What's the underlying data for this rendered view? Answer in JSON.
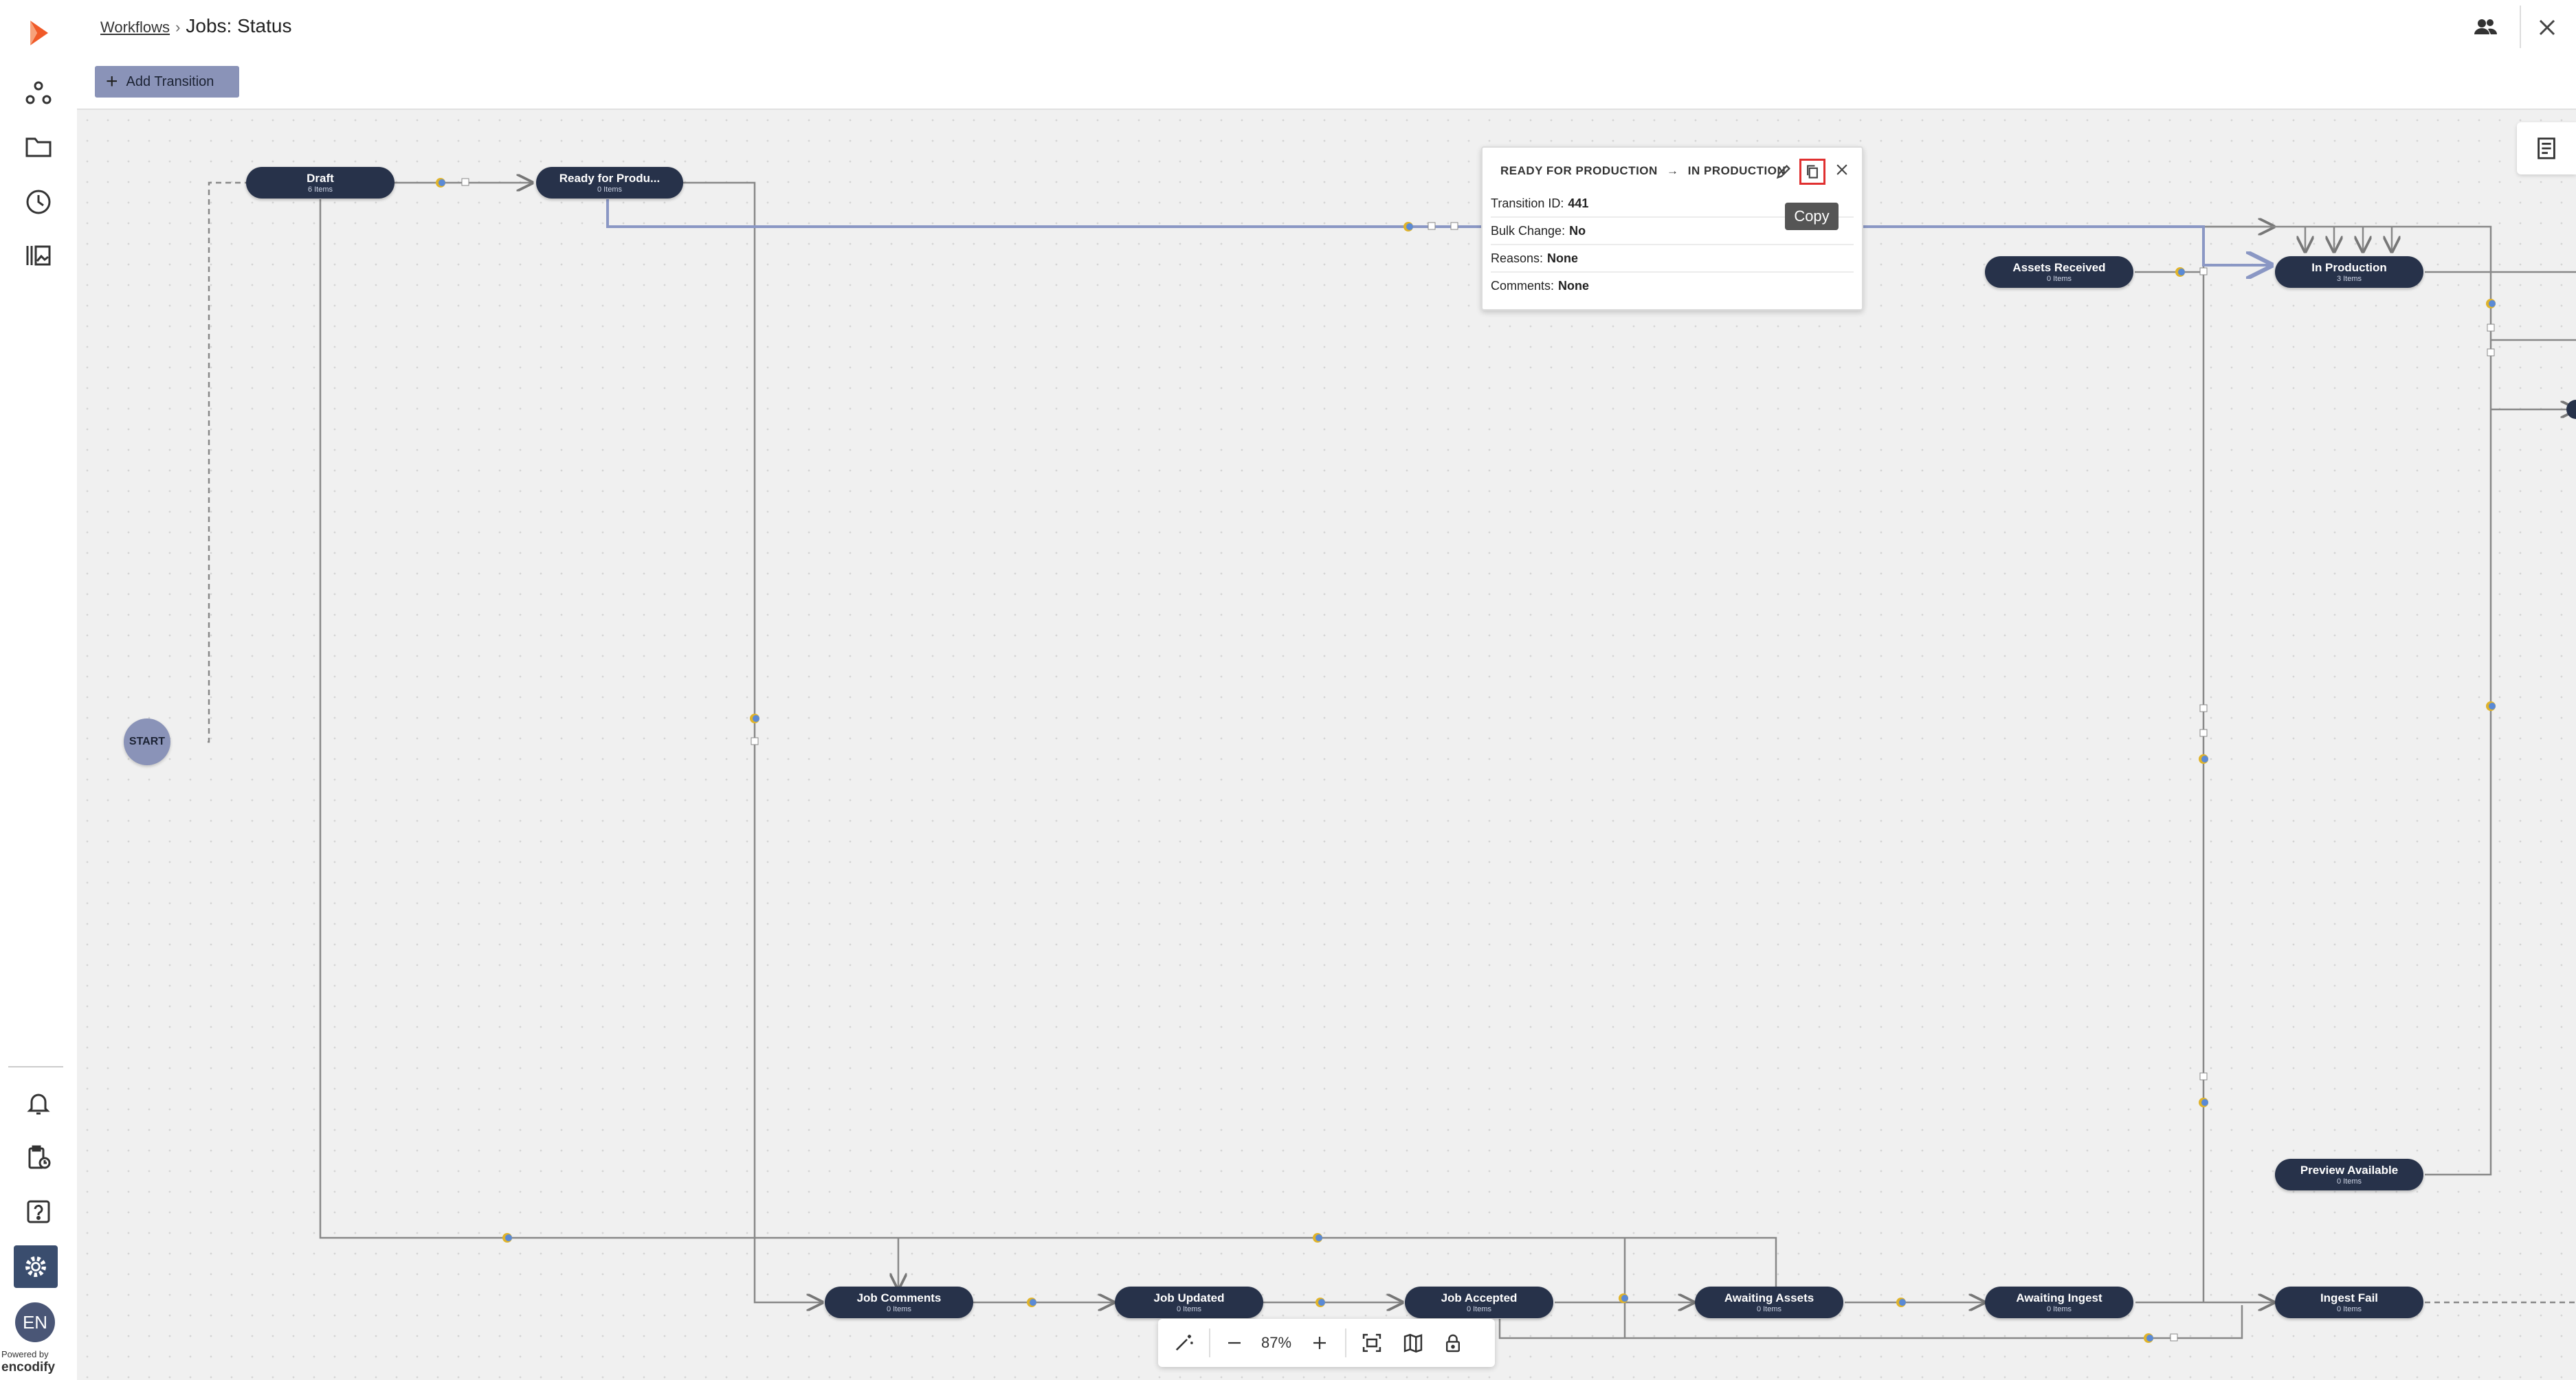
{
  "header": {
    "breadcrumb_parent": "Workflows",
    "breadcrumb_sep": "›",
    "title": "Jobs: Status"
  },
  "toolbar": {
    "add_transition_label": "Add Transition"
  },
  "sidebar": {
    "icons": [
      "logo-icon",
      "workflow-icon",
      "folder-icon",
      "clock-icon",
      "library-icon",
      "bell-icon",
      "clipboard-clock-icon",
      "help-icon",
      "gear-icon"
    ],
    "avatar": "EN",
    "powered_by": "Powered by",
    "brand": "encodify"
  },
  "start_label": "START",
  "nodes": [
    {
      "name": "Draft",
      "count": "6 Items"
    },
    {
      "name": "Ready for Produ...",
      "count": "0 Items"
    },
    {
      "name": "Assets Received",
      "count": "0 Items"
    },
    {
      "name": "In Production",
      "count": "3 Items"
    },
    {
      "name": "Preview Available",
      "count": "0 Items"
    },
    {
      "name": "Job Comments",
      "count": "0 Items"
    },
    {
      "name": "Job Updated",
      "count": "0 Items"
    },
    {
      "name": "Job Accepted",
      "count": "0 Items"
    },
    {
      "name": "Awaiting Assets",
      "count": "0 Items"
    },
    {
      "name": "Awaiting Ingest",
      "count": "0 Items"
    },
    {
      "name": "Ingest Fail",
      "count": "0 Items"
    }
  ],
  "popup": {
    "from": "READY FOR PRODUCTION",
    "arrow": "→",
    "to": "IN PRODUCTION",
    "transition_id_label": "Transition ID:",
    "transition_id": "441",
    "bulk_change_label": "Bulk Change:",
    "bulk_change": "No",
    "reasons_label": "Reasons:",
    "reasons": "None",
    "comments_label": "Comments:",
    "comments": "None",
    "tooltip": "Copy"
  },
  "zoom": {
    "level": "87%"
  },
  "colors": {
    "node": "#27324a",
    "accent": "#f05a28",
    "selected_path": "#8a97c4",
    "button": "#8a93b8"
  }
}
